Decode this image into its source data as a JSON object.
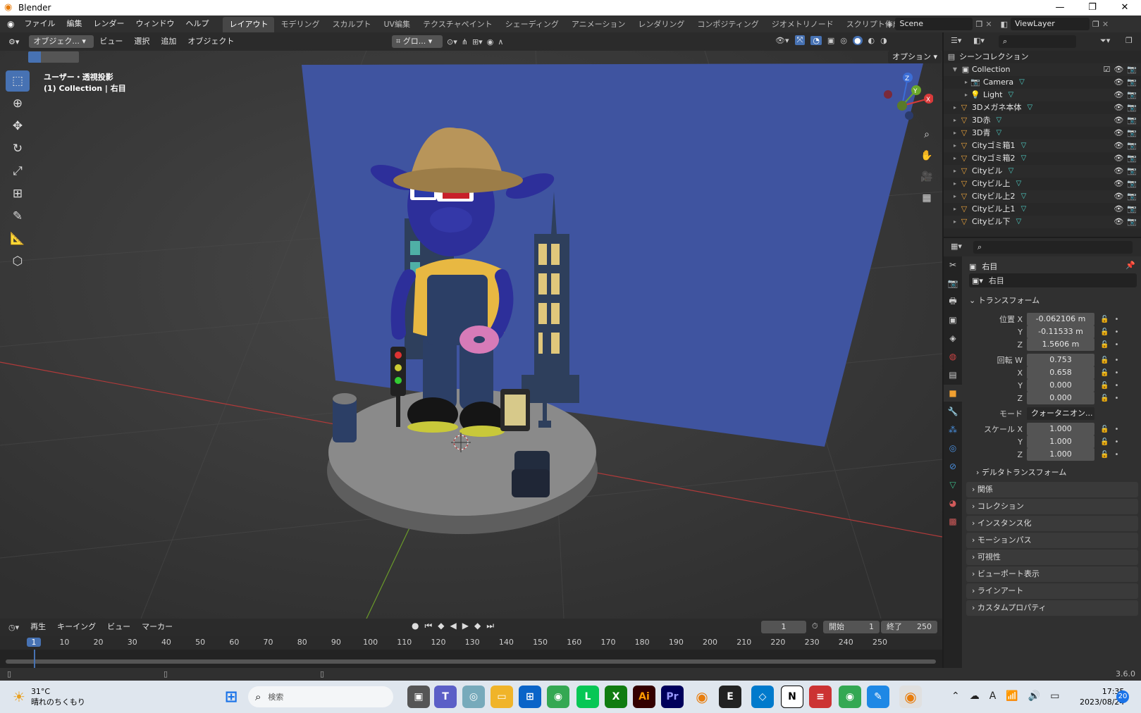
{
  "window": {
    "title": "Blender",
    "min": "—",
    "max": "❐",
    "close": "✕"
  },
  "menu": [
    "ファイル",
    "編集",
    "レンダー",
    "ウィンドウ",
    "ヘルプ"
  ],
  "workspaces": [
    "レイアウト",
    "モデリング",
    "スカルプト",
    "UV編集",
    "テクスチャペイント",
    "シェーディング",
    "アニメーション",
    "レンダリング",
    "コンポジティング",
    "ジオメトリノード",
    "スクリプト作成"
  ],
  "scene": "Scene",
  "viewlayer": "ViewLayer",
  "viewport": {
    "mode": "オブジェク...",
    "menus": [
      "ビュー",
      "選択",
      "追加",
      "オブジェクト"
    ],
    "orientation": "グロ...",
    "options": "オプション",
    "view_label": "ユーザー・透視投影",
    "object_label": "(1) Collection | 右目"
  },
  "gizmo": {
    "z": "Z",
    "y": "Y",
    "x": "X"
  },
  "outliner": {
    "root": "シーンコレクション",
    "collection": "Collection",
    "items": [
      {
        "name": "Camera",
        "indent": 2
      },
      {
        "name": "Light",
        "indent": 2
      },
      {
        "name": "3Dメガネ本体",
        "indent": 1
      },
      {
        "name": "3D赤",
        "indent": 1
      },
      {
        "name": "3D青",
        "indent": 1
      },
      {
        "name": "Cityゴミ箱1",
        "indent": 1
      },
      {
        "name": "Cityゴミ箱2",
        "indent": 1
      },
      {
        "name": "Cityビル",
        "indent": 1
      },
      {
        "name": "Cityビル上",
        "indent": 1
      },
      {
        "name": "Cityビル上2",
        "indent": 1
      },
      {
        "name": "Cityビル上1",
        "indent": 1
      },
      {
        "name": "Cityビル下",
        "indent": 1
      }
    ]
  },
  "properties": {
    "object_name": "右目",
    "object_field": "右目",
    "transform_title": "トランスフォーム",
    "location": {
      "label": "位置",
      "x": "-0.062106 m",
      "y": "-0.11533 m",
      "z": "1.5606 m"
    },
    "rotation": {
      "label": "回転",
      "w": "0.753",
      "x": "0.658",
      "y": "0.000",
      "z": "0.000"
    },
    "mode_label": "モード",
    "mode_value": "クォータニオン...",
    "scale": {
      "label": "スケール",
      "x": "1.000",
      "y": "1.000",
      "z": "1.000"
    },
    "axis": {
      "x": "X",
      "y": "Y",
      "z": "Z",
      "w": "W"
    },
    "delta": "デルタトランスフォーム",
    "panels": [
      "関係",
      "コレクション",
      "インスタンス化",
      "モーションパス",
      "可視性",
      "ビューポート表示",
      "ラインアート",
      "カスタムプロパティ"
    ]
  },
  "timeline": {
    "menus": [
      "再生",
      "キーイング",
      "ビュー",
      "マーカー"
    ],
    "current": "1",
    "start_label": "開始",
    "start": "1",
    "end_label": "終了",
    "end": "250",
    "ticks": [
      "1",
      "10",
      "20",
      "30",
      "40",
      "50",
      "60",
      "70",
      "80",
      "90",
      "100",
      "110",
      "120",
      "130",
      "140",
      "150",
      "160",
      "170",
      "180",
      "190",
      "200",
      "210",
      "220",
      "230",
      "240",
      "250"
    ]
  },
  "version": "3.6.0",
  "taskbar": {
    "weather_temp": "31°C",
    "weather_desc": "晴れのちくもり",
    "search": "検索",
    "time": "17:35",
    "date": "2023/08/24",
    "notif": "20"
  },
  "colors": {
    "accent": "#4772b3",
    "bg_plane": "#3f54a0",
    "orange": "#e87d0d"
  }
}
